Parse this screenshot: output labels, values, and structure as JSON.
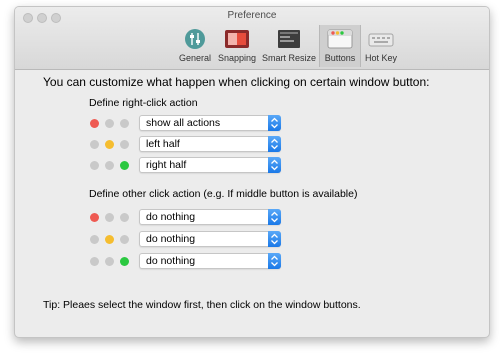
{
  "window": {
    "title": "Preference"
  },
  "toolbar": [
    {
      "label": "General",
      "icon": "sliders-icon"
    },
    {
      "label": "Snapping",
      "icon": "snapping-icon"
    },
    {
      "label": "Smart Resize",
      "icon": "smart-resize-icon"
    },
    {
      "label": "Buttons",
      "icon": "buttons-icon",
      "selected": true
    },
    {
      "label": "Hot Key",
      "icon": "keyboard-icon"
    }
  ],
  "main": {
    "heading": "You can customize what happen when clicking on certain window button:",
    "right_click": {
      "title": "Define right-click action",
      "rows": [
        {
          "button": "close",
          "value": "show all actions"
        },
        {
          "button": "minimize",
          "value": "left half"
        },
        {
          "button": "zoom",
          "value": "right half"
        }
      ]
    },
    "other_click": {
      "title": "Define other click action (e.g. If middle button is available)",
      "rows": [
        {
          "button": "close",
          "value": "do nothing"
        },
        {
          "button": "minimize",
          "value": "do nothing"
        },
        {
          "button": "zoom",
          "value": "do nothing"
        }
      ]
    },
    "tip": "Tip: Pleaes select the window first, then click on the window buttons."
  },
  "colors": {
    "close": "#ee5a52",
    "minimize": "#f5bd2f",
    "zoom": "#2bc840",
    "inactive": "#c9c9c9",
    "accent": "#2a86f0"
  }
}
